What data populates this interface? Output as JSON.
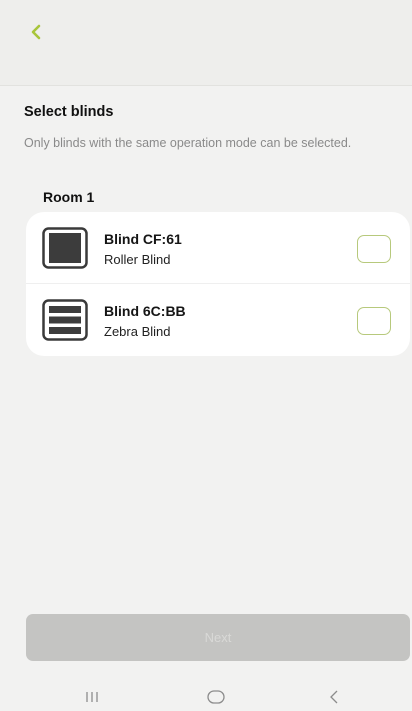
{
  "header": {
    "back_icon": "chevron-left-icon",
    "accent_color": "#a8c53a"
  },
  "content": {
    "title": "Select blinds",
    "subtitle": "Only blinds with the same operation mode can be selected."
  },
  "rooms": [
    {
      "name": "Room 1",
      "blinds": [
        {
          "name": "Blind CF:61",
          "type": "Roller Blind",
          "icon": "roller-blind-icon",
          "checked": false
        },
        {
          "name": "Blind 6C:BB",
          "type": "Zebra Blind",
          "icon": "zebra-blind-icon",
          "checked": false
        }
      ]
    }
  ],
  "footer": {
    "next_label": "Next",
    "next_enabled": false
  },
  "system_nav": {
    "recents_icon": "recents-icon",
    "home_icon": "home-icon",
    "back_icon": "system-back-icon"
  }
}
